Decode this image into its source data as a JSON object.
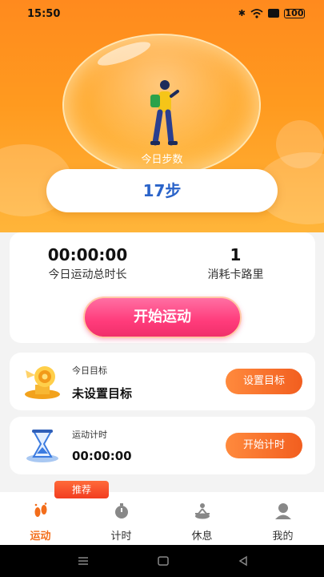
{
  "status_bar": {
    "time": "15:50",
    "battery": "100"
  },
  "hero": {
    "steps_label": "今日步数",
    "steps_value": "17步"
  },
  "stats": {
    "duration_value": "00:00:00",
    "duration_label": "今日运动总时长",
    "calories_value": "1",
    "calories_label": "消耗卡路里",
    "start_button": "开始运动"
  },
  "goal": {
    "small_label": "今日目标",
    "value": "未设置目标",
    "button": "设置目标"
  },
  "timer": {
    "small_label": "运动计时",
    "value": "00:00:00",
    "button": "开始计时"
  },
  "tabbar": {
    "badge": "推荐",
    "items": [
      {
        "label": "运动",
        "icon": "footprints-icon",
        "active": true
      },
      {
        "label": "计时",
        "icon": "stopwatch-icon",
        "active": false
      },
      {
        "label": "休息",
        "icon": "meditation-icon",
        "active": false
      },
      {
        "label": "我的",
        "icon": "profile-icon",
        "active": false
      }
    ]
  },
  "colors": {
    "accent": "#f36d1a",
    "steps_blue": "#2a63c9",
    "pink_button": "#ff3b7b",
    "hero_orange": "#ff9a1f"
  }
}
